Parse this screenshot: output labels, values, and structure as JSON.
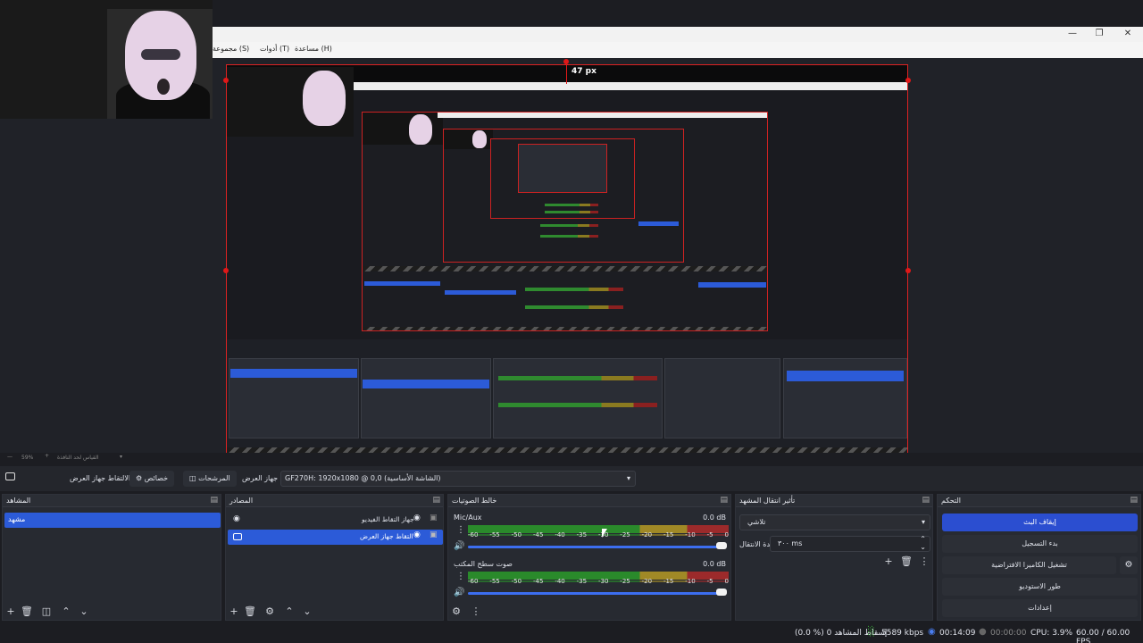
{
  "menu": {
    "scene_collection": "مجموعة (S) ",
    "tools": "أدوات (T)",
    "help": "مساعدة (H)"
  },
  "preview": {
    "measure_label": "47 px"
  },
  "zoom": {
    "percent": "59%",
    "label": "القياس لحد النافذة"
  },
  "source_toolbar": {
    "label": "جهاز الالتقاط جهاز العرض",
    "properties": "خصائص",
    "filters": "المرشحات",
    "display_label": "جهاز العرض",
    "display_value": "GF270H: 1920x1080 @ 0,0 (الشاشة الأساسية)"
  },
  "scenes": {
    "title": "المشاهد",
    "items": [
      "مشهد"
    ]
  },
  "sources": {
    "title": "المصادر",
    "items": [
      "جهاز التقاط الفيديو",
      "التقاط جهاز العرض"
    ]
  },
  "mixer": {
    "title": "خالط الصوتيات",
    "channels": [
      {
        "name": "Mic/Aux",
        "db": "0.0 dB",
        "level": 0.84
      },
      {
        "name": "صوت سطح المكتب",
        "db": "0.0 dB",
        "level": 0.84
      }
    ],
    "scale": [
      "-60",
      "-55",
      "-50",
      "-45",
      "-40",
      "-35",
      "-30",
      "-25",
      "-20",
      "-15",
      "-10",
      "-5",
      "0"
    ]
  },
  "transitions": {
    "title": "تأثير انتقال المشهد",
    "selected": "تلاشي",
    "duration_label": "مدة الانتقال",
    "duration_value": "٣٠٠ ms"
  },
  "controls": {
    "title": "التحكم",
    "stop_stream": "إيقاف البث",
    "start_recording": "بدء التسجيل",
    "virtual_camera": "تشغيل الكاميرا الافتراضية",
    "studio_mode": "طور الاستوديو",
    "settings": "إعدادات"
  },
  "status": {
    "dropped": "(0.0 %) إسقاط المشاهد 0",
    "bitrate": "5589 kbps",
    "stream_time": "00:14:09",
    "rec_time": "00:00:00",
    "cpu": "CPU: 3.9%",
    "fps": "60.00 / 60.00 FPS"
  },
  "colors": {
    "accent": "#2b4ed0",
    "selection": "#2c5bd8",
    "border_red": "#e01818"
  }
}
